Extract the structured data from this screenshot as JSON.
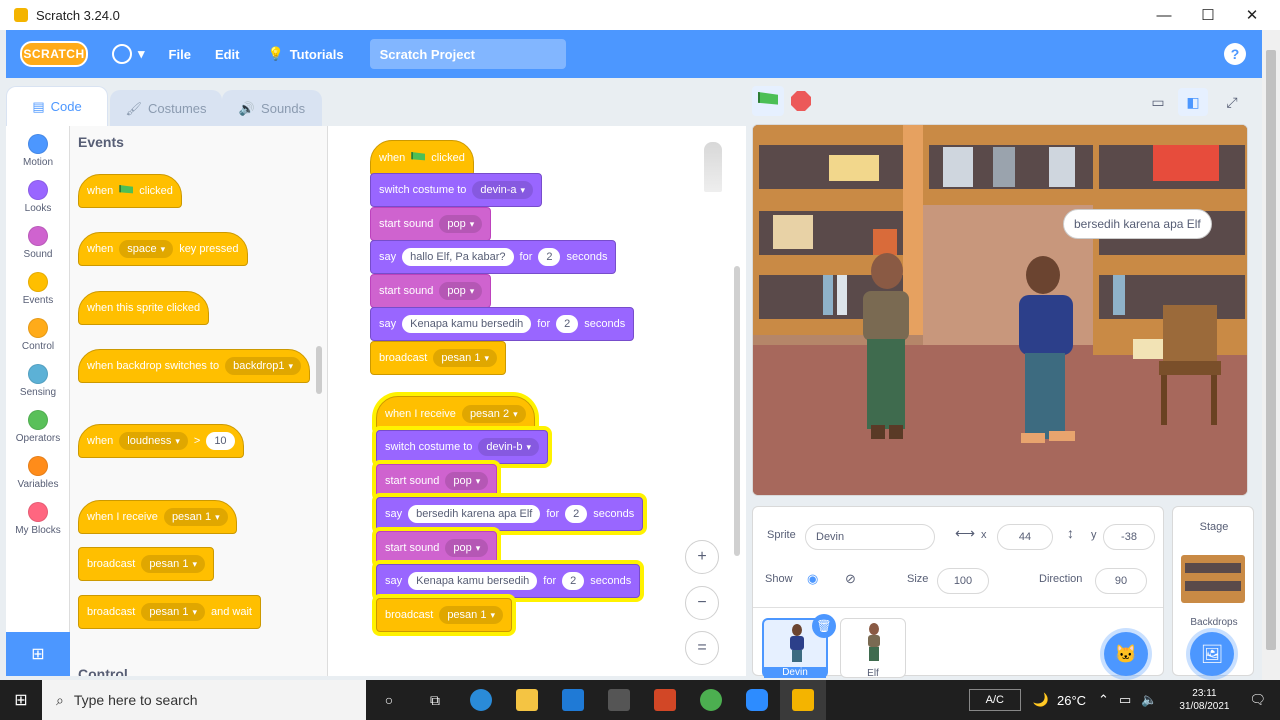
{
  "window": {
    "title": "Scratch 3.24.0",
    "minimize": "—",
    "maximize": "☐",
    "close": "✕"
  },
  "menubar": {
    "logo": "SCRATCH",
    "file": "File",
    "edit": "Edit",
    "tutorials": "Tutorials",
    "project_title": "Scratch Project",
    "help": "?"
  },
  "tabs": {
    "code": "Code",
    "costumes": "Costumes",
    "sounds": "Sounds"
  },
  "categories": [
    {
      "label": "Motion",
      "color": "#4c97ff"
    },
    {
      "label": "Looks",
      "color": "#9966ff"
    },
    {
      "label": "Sound",
      "color": "#cf63cf"
    },
    {
      "label": "Events",
      "color": "#ffbf00"
    },
    {
      "label": "Control",
      "color": "#ffab19"
    },
    {
      "label": "Sensing",
      "color": "#5cb1d6"
    },
    {
      "label": "Operators",
      "color": "#59c059"
    },
    {
      "label": "Variables",
      "color": "#ff8c1a"
    },
    {
      "label": "My Blocks",
      "color": "#ff6680"
    }
  ],
  "palette": {
    "heading": "Events",
    "heading_next": "Control",
    "when_flag": {
      "when": "when",
      "clicked": "clicked"
    },
    "when_key": {
      "when": "when",
      "key": "space",
      "rest": "key pressed"
    },
    "when_sprite": "when this sprite clicked",
    "when_backdrop": {
      "text": "when backdrop switches to",
      "value": "backdrop1"
    },
    "when_loudness": {
      "when": "when",
      "what": "loudness",
      "op": ">",
      "value": "10"
    },
    "when_receive": {
      "text": "when I receive",
      "value": "pesan 1"
    },
    "broadcast": {
      "text": "broadcast",
      "value": "pesan 1"
    },
    "broadcast_wait": {
      "text": "broadcast",
      "value": "pesan 1",
      "rest": "and wait"
    }
  },
  "script1": {
    "hat": {
      "when": "when",
      "clicked": "clicked"
    },
    "switch": {
      "text": "switch costume to",
      "value": "devin-a"
    },
    "sound1": {
      "text": "start sound",
      "value": "pop"
    },
    "say1": {
      "say": "say",
      "msg": "hallo Elf, Pa kabar?",
      "for": "for",
      "secs": "2",
      "unit": "seconds"
    },
    "sound2": {
      "text": "start sound",
      "value": "pop"
    },
    "say2": {
      "say": "say",
      "msg": "Kenapa kamu bersedih",
      "for": "for",
      "secs": "2",
      "unit": "seconds"
    },
    "broadcast": {
      "text": "broadcast",
      "value": "pesan 1"
    }
  },
  "script2": {
    "hat": {
      "text": "when I receive",
      "value": "pesan 2"
    },
    "switch": {
      "text": "switch costume to",
      "value": "devin-b"
    },
    "sound1": {
      "text": "start sound",
      "value": "pop"
    },
    "say1": {
      "say": "say",
      "msg": "bersedih karena apa Elf",
      "for": "for",
      "secs": "2",
      "unit": "seconds"
    },
    "sound2": {
      "text": "start sound",
      "value": "pop"
    },
    "say2": {
      "say": "say",
      "msg": "Kenapa kamu bersedih",
      "for": "for",
      "secs": "2",
      "unit": "seconds"
    },
    "broadcast": {
      "text": "broadcast",
      "value": "pesan 1"
    }
  },
  "zoom": {
    "in": "+",
    "out": "−",
    "reset": "="
  },
  "stage": {
    "bubble": "bersedih karena apa Elf"
  },
  "sprite_info": {
    "sprite_label": "Sprite",
    "sprite_name": "Devin",
    "x_label": "x",
    "x_value": "44",
    "y_label": "y",
    "y_value": "-38",
    "show_label": "Show",
    "size_label": "Size",
    "size_value": "100",
    "direction_label": "Direction",
    "direction_value": "90"
  },
  "sprites": [
    {
      "name": "Devin"
    },
    {
      "name": "Elf"
    }
  ],
  "stage_panel": {
    "title": "Stage",
    "backdrops": "Backdrops"
  },
  "taskbar": {
    "search_placeholder": "Type here to search",
    "ac": "A/C",
    "temp": "26°C",
    "time": "23:11",
    "date": "31/08/2021"
  }
}
